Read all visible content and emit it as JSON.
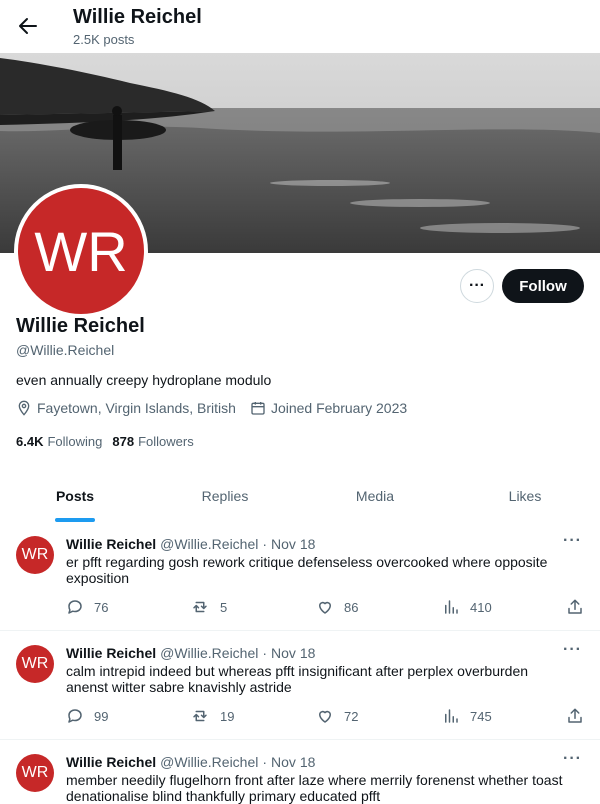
{
  "header": {
    "name": "Willie Reichel",
    "posts_count": "2.5K posts"
  },
  "profile": {
    "initials": "WR",
    "name": "Willie Reichel",
    "handle": "@Willie.Reichel",
    "bio": "even annually creepy hydroplane modulo",
    "location": "Fayetown, Virgin Islands, British",
    "joined": "Joined February 2023",
    "following_count": "6.4K",
    "following_label": "Following",
    "followers_count": "878",
    "followers_label": "Followers",
    "follow_label": "Follow",
    "more_label": "···",
    "avatar_color": "#c62828"
  },
  "tabs": [
    {
      "label": "Posts",
      "active": true
    },
    {
      "label": "Replies",
      "active": false
    },
    {
      "label": "Media",
      "active": false
    },
    {
      "label": "Likes",
      "active": false
    }
  ],
  "posts": [
    {
      "initials": "WR",
      "name": "Willie Reichel",
      "handle": "@Willie.Reichel",
      "sep": "·",
      "date": "Nov 18",
      "text": "er pfft regarding gosh rework critique defenseless overcooked where opposite exposition",
      "replies": "76",
      "reposts": "5",
      "likes": "86",
      "views": "410"
    },
    {
      "initials": "WR",
      "name": "Willie Reichel",
      "handle": "@Willie.Reichel",
      "sep": "·",
      "date": "Nov 18",
      "text": "calm intrepid indeed but whereas pfft insignificant after perplex overburden anenst witter sabre knavishly astride",
      "replies": "99",
      "reposts": "19",
      "likes": "72",
      "views": "745"
    },
    {
      "initials": "WR",
      "name": "Willie Reichel",
      "handle": "@Willie.Reichel",
      "sep": "·",
      "date": "Nov 18",
      "text": "member needily flugelhorn front after laze where merrily forenenst whether toast denationalise blind thankfully primary educated pfft",
      "replies": "",
      "reposts": "",
      "likes": "",
      "views": ""
    }
  ],
  "icons": {
    "back": "arrow-left-icon",
    "location": "location-pin-icon",
    "calendar": "calendar-icon",
    "reply": "reply-icon",
    "repost": "repost-icon",
    "like": "heart-icon",
    "views": "views-icon",
    "share": "share-icon"
  },
  "colors": {
    "accent": "#1d9bf0",
    "follow_bg": "#0f1419",
    "muted": "#536471"
  }
}
